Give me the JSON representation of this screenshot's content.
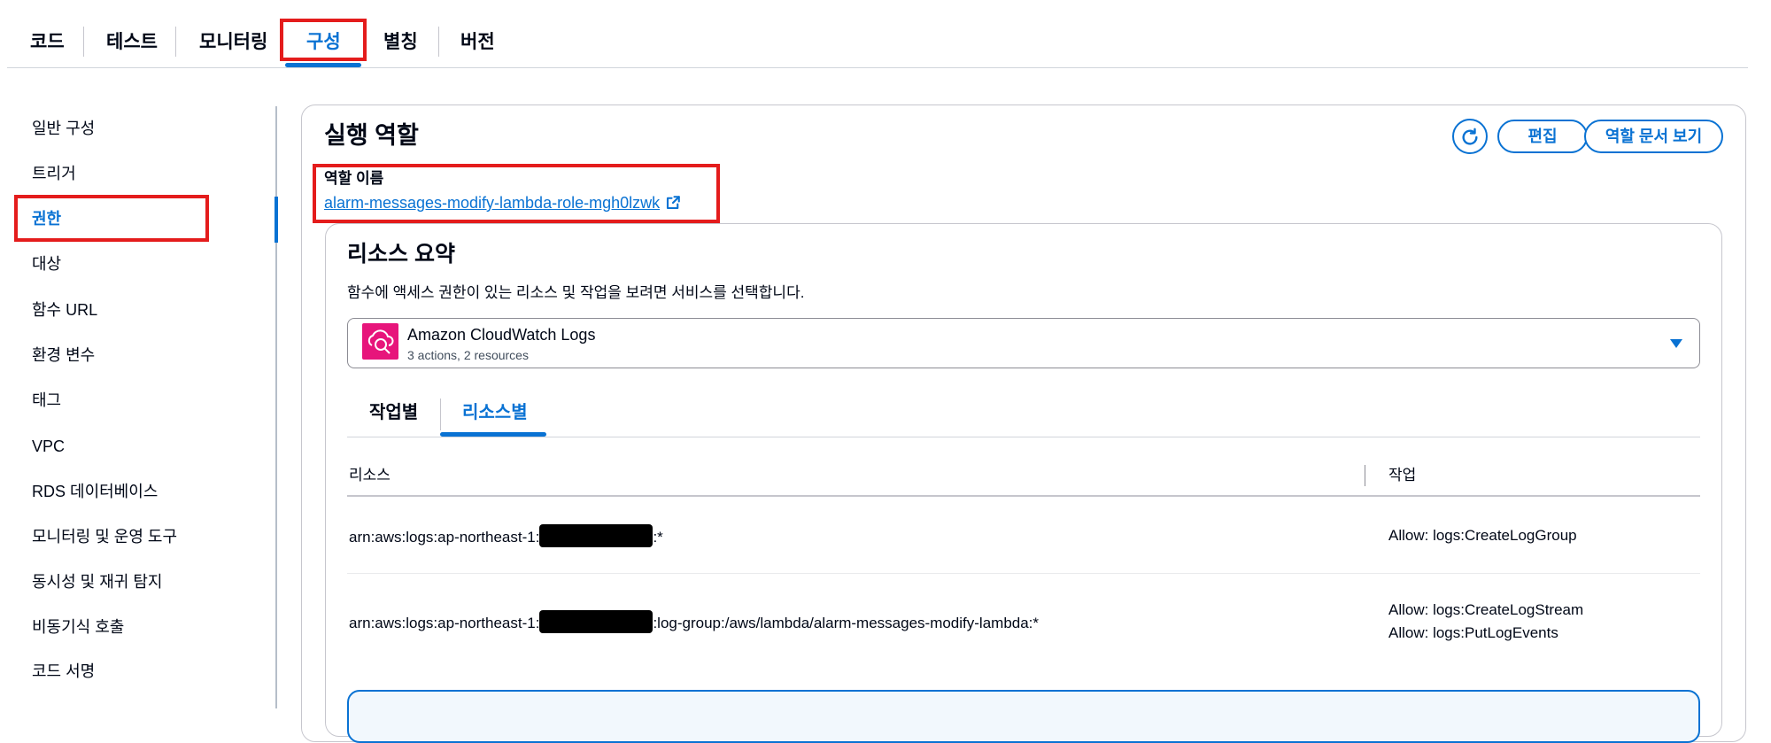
{
  "top_tabs": [
    {
      "label": "코드"
    },
    {
      "label": "테스트"
    },
    {
      "label": "모니터링"
    },
    {
      "label": "구성",
      "active": true
    },
    {
      "label": "별칭"
    },
    {
      "label": "버전"
    }
  ],
  "sidebar": {
    "items": [
      {
        "label": "일반 구성"
      },
      {
        "label": "트리거"
      },
      {
        "label": "권한",
        "active": true
      },
      {
        "label": "대상"
      },
      {
        "label": "함수 URL"
      },
      {
        "label": "환경 변수"
      },
      {
        "label": "태그"
      },
      {
        "label": "VPC"
      },
      {
        "label": "RDS 데이터베이스"
      },
      {
        "label": "모니터링 및 운영 도구"
      },
      {
        "label": "동시성 및 재귀 탐지"
      },
      {
        "label": "비동기식 호출"
      },
      {
        "label": "코드 서명"
      }
    ]
  },
  "execution_role": {
    "title": "실행 역할",
    "refresh_icon": "refresh-icon",
    "edit_label": "편집",
    "view_doc_label": "역할 문서 보기",
    "role_name_label": "역할 이름",
    "role_name": "alarm-messages-modify-lambda-role-mgh0lzwk",
    "external_icon": "external-link-icon"
  },
  "resource_summary": {
    "title": "리소스 요약",
    "description": "함수에 액세스 권한이 있는 리소스 및 작업을 보려면 서비스를 선택합니다.",
    "service": {
      "name": "Amazon CloudWatch Logs",
      "sub": "3 actions, 2 resources",
      "icon": "cloudwatch-logs-icon",
      "icon_color": "#e7157b"
    },
    "tabs": [
      {
        "label": "작업별"
      },
      {
        "label": "리소스별",
        "active": true
      }
    ],
    "columns": {
      "resource": "리소스",
      "action": "작업"
    },
    "rows": [
      {
        "resource_prefix": "arn:aws:logs:ap-northeast-1:",
        "resource_suffix": ":*",
        "actions": [
          "Allow: logs:CreateLogGroup"
        ]
      },
      {
        "resource_prefix": "arn:aws:logs:ap-northeast-1:",
        "resource_suffix": ":log-group:/aws/lambda/alarm-messages-modify-lambda:*",
        "actions": [
          "Allow: logs:CreateLogStream",
          "Allow: logs:PutLogEvents"
        ]
      }
    ]
  },
  "colors": {
    "accent": "#0972d3",
    "highlight": "#e41c1c"
  }
}
